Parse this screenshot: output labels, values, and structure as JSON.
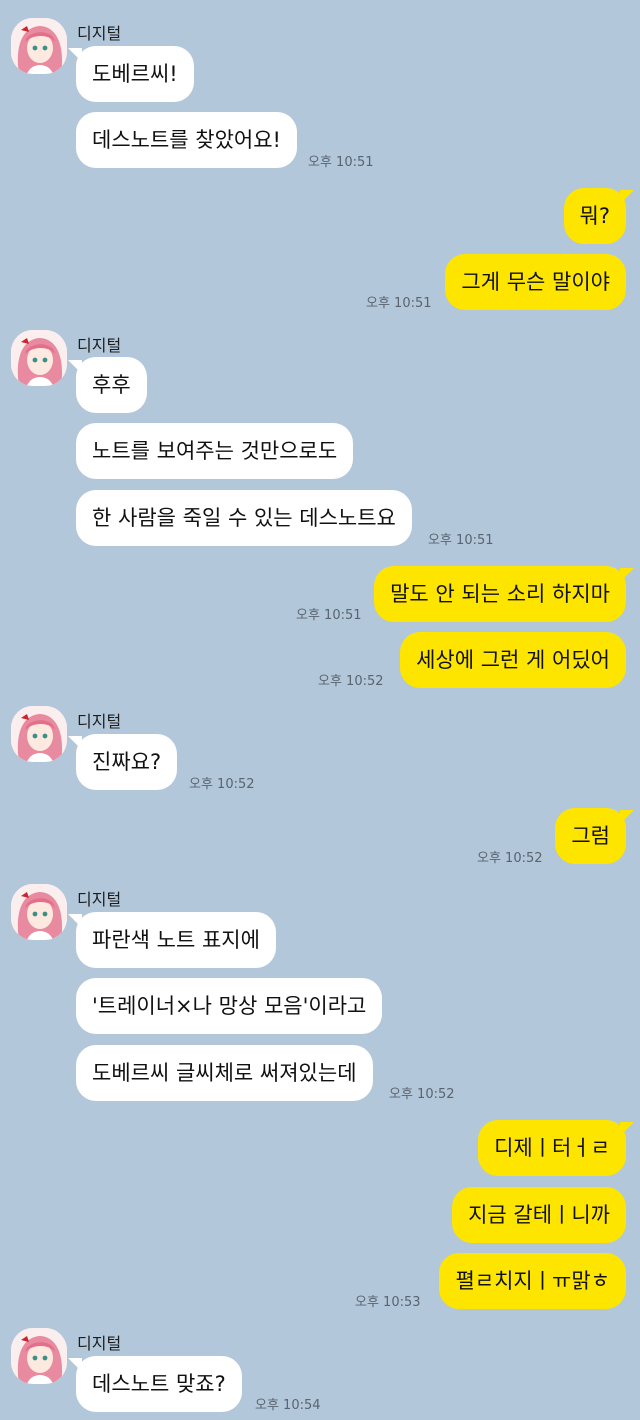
{
  "sender": "디지털",
  "messages": [
    {
      "text": "도베르씨!"
    },
    {
      "text": "데스노트를 찾았어요!",
      "time": "오후 10:51"
    },
    {
      "text": "뭐?"
    },
    {
      "text": "그게 무슨 말이야",
      "time": "오후 10:51"
    },
    {
      "text": "후후"
    },
    {
      "text": "노트를 보여주는 것만으로도"
    },
    {
      "text": "한 사람을 죽일 수 있는 데스노트요",
      "time": "오후 10:51"
    },
    {
      "text": "말도 안 되는 소리 하지마",
      "time": "오후 10:51"
    },
    {
      "text": "세상에 그런 게 어딨어",
      "time": "오후 10:52"
    },
    {
      "text": "진짜요?",
      "time": "오후 10:52"
    },
    {
      "text": "그럼",
      "time": "오후 10:52"
    },
    {
      "text": "파란색 노트 표지에"
    },
    {
      "text": "'트레이너×나 망상 모음'이라고"
    },
    {
      "text": "도베르씨 글씨체로 써져있는데",
      "time": "오후 10:52"
    },
    {
      "text": "디제ㅣ터ㅓㄹ"
    },
    {
      "text": "지금 갈테ㅣ니까"
    },
    {
      "text": "펼ㄹ치지ㅣㅠ맑ㅎ",
      "time": "오후 10:53"
    },
    {
      "text": "데스노트 맞죠?",
      "time": "오후 10:54"
    }
  ]
}
